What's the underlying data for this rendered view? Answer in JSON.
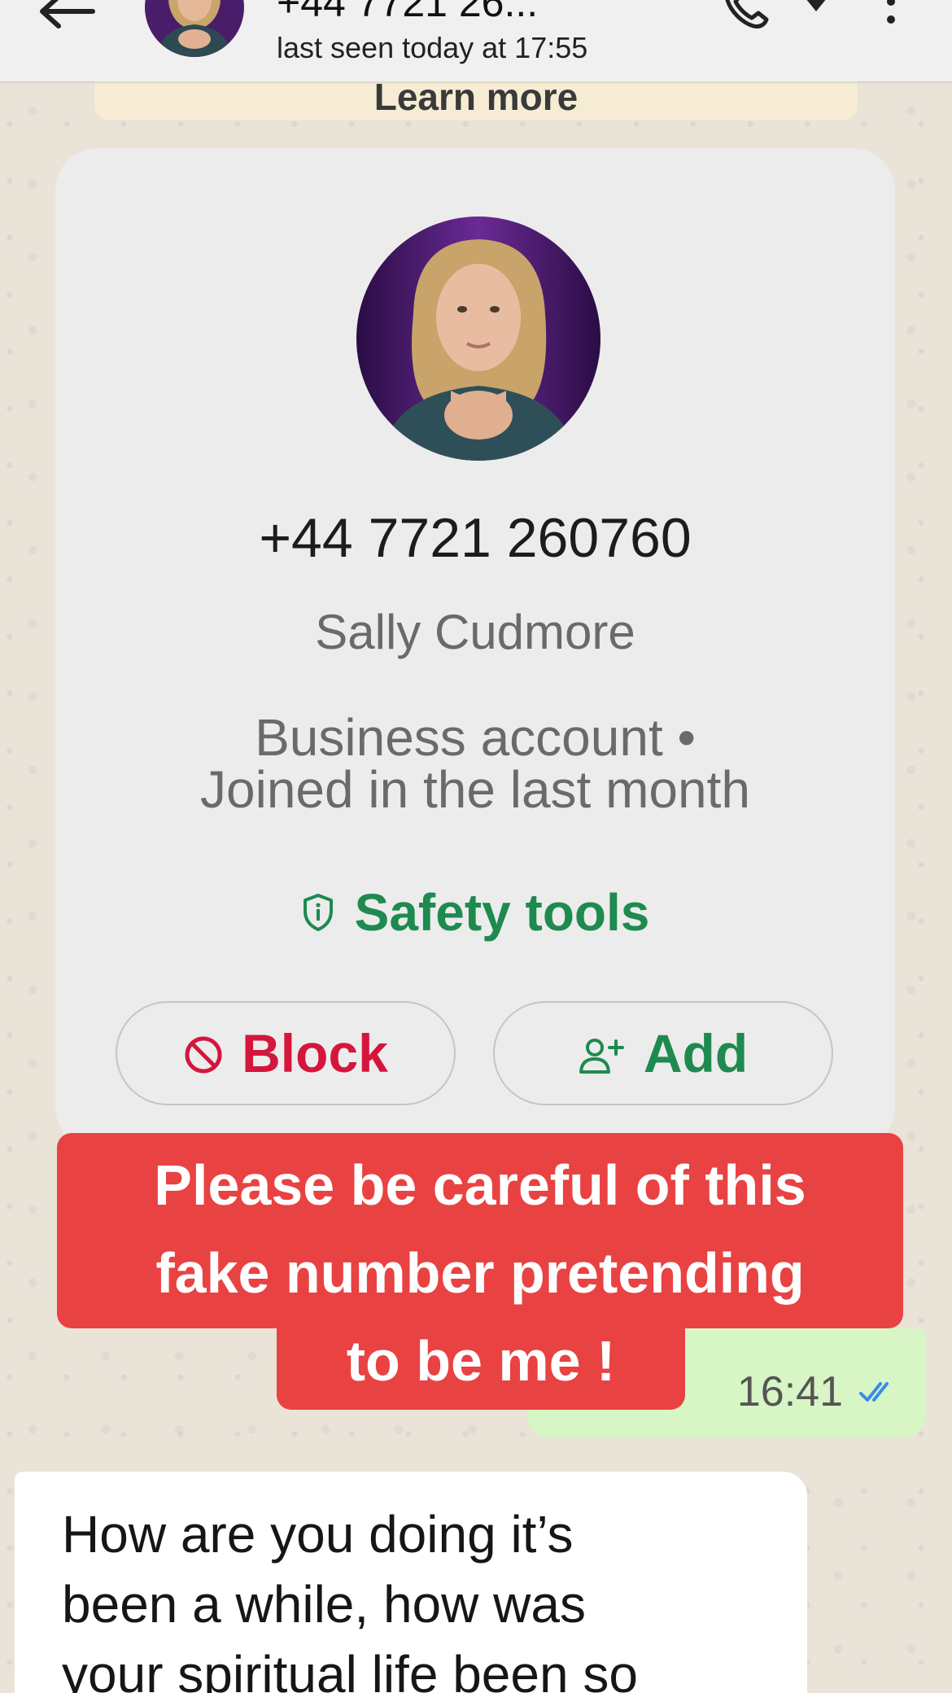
{
  "header": {
    "title": "+44 7721 26...",
    "status": "last seen today at 17:55"
  },
  "notice": {
    "link_label": "Learn more"
  },
  "contact_card": {
    "phone": "+44 7721 260760",
    "name": "Sally Cudmore",
    "account_line1": "Business account •",
    "account_line2": "Joined in the last month",
    "safety_label": "Safety tools",
    "block_label": "Block",
    "add_label": "Add"
  },
  "messages": {
    "outgoing_time": "16:41",
    "incoming_text": "How are you doing it’s\nbeen a while, how was\nyour spiritual life been so"
  },
  "overlay": {
    "line1": "Please be careful of this",
    "line2": "fake number pretending",
    "line3": "to be me !"
  },
  "colors": {
    "header_bg": "#f0f0f0",
    "card_bg": "#ececec",
    "accent_green": "#1e8a4f",
    "block_red": "#d4163c",
    "overlay_red": "#e94242",
    "outgoing_bubble": "#d8f5c6",
    "read_ticks": "#3b8ce8"
  },
  "icons": {
    "back": "arrow-left-icon",
    "call": "phone-icon",
    "call_menu": "chevron-down-icon",
    "more": "more-vertical-icon",
    "safety": "shield-icon",
    "block": "block-circle-icon",
    "add": "add-person-icon",
    "ticks": "double-check-icon"
  }
}
